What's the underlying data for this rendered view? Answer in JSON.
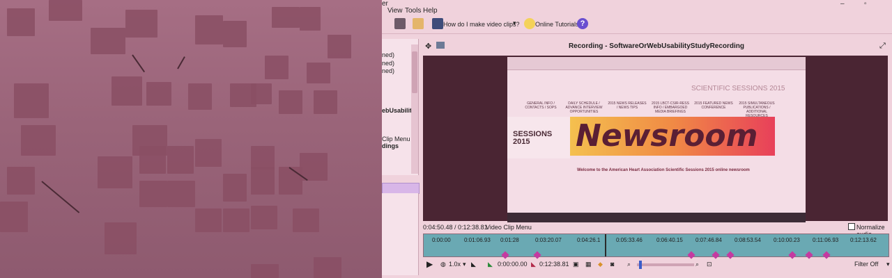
{
  "menu": {
    "title_fragment": "er",
    "items": [
      "View",
      "Tools",
      "Help"
    ]
  },
  "toolbar": {
    "video_help": "How do I make video clips?",
    "tutorials": "Online Tutorials",
    "help_badge": "?"
  },
  "tree": {
    "items": [
      "ned)",
      "ned)",
      "ned)",
      "ebUsability",
      "Clip Menu",
      "dings"
    ]
  },
  "recording": {
    "title": "Recording - SoftwareOrWebUsabilityStudyRecording"
  },
  "video_content": {
    "newsroom": "Newsroom",
    "science": "SCIENTIFIC SESSIONS 2015",
    "sessions_logo": "SESSIONS\n2015",
    "nav": [
      "GENERAL INFO / CONTACTS / SOPS",
      "DAILY SCHEDULE / ADVANCE INTERVIEW OPPORTUNITIES",
      "2015 NEWS RELEASES / NEWS TIPS",
      "2015 LBCT-CSIR-RESS INFO / EMBARGOED MEDIA BRIEFINGS",
      "2015 FEATURED NEWS CONFERENCE",
      "2015 SIMULTANEOUS PUBLICATIONS / ADDITIONAL RESOURCES"
    ],
    "welcome": "Welcome to the American Heart Association Scientific Sessions 2015 online newsroom"
  },
  "status": {
    "time": "0:04:50.48 / 0:12:38.81",
    "clip_menu": "Video Clip Menu",
    "normalize": "Normalize audio"
  },
  "timeline": {
    "ticks": [
      "0:00:00",
      "0:01:06.93",
      "0:01:28",
      "0:03:20.07",
      "0:04:26.1",
      "0:05:33.46",
      "0:06:40.15",
      "0:07:46.84",
      "0:08:53.54",
      "0:10:00.23",
      "0:11:06.93",
      "0:12:13.62"
    ]
  },
  "controls": {
    "speed": "1.0x",
    "start_time": "0:00:00.00",
    "end_time": "0:12:38.81",
    "filter": "Filter Off"
  }
}
